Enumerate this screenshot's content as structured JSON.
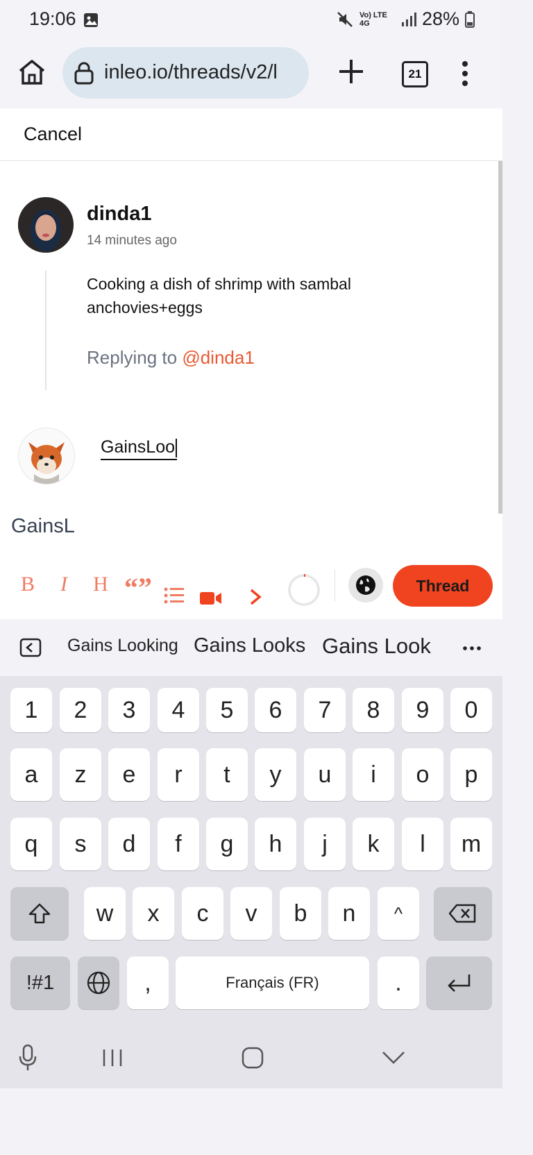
{
  "status": {
    "time": "19:06",
    "network": "Vo) LTE 4G",
    "battery": "28%"
  },
  "browser": {
    "url": "inleo.io/threads/v2/l",
    "tab_count": "21",
    "icons": [
      "home-icon",
      "lock-icon",
      "plus-icon",
      "menu-icon"
    ]
  },
  "composer": {
    "cancel_label": "Cancel",
    "parent": {
      "author": "dinda1",
      "time_ago": "14 minutes ago",
      "text": "Cooking a dish of shrimp with sambal anchovies+eggs"
    },
    "replying_prefix": "Replying to",
    "replying_handle": "@dinda1",
    "input_value": "GainsLoo",
    "preview_text": "GainsL",
    "submit_label": "Thread",
    "accent": "#f0431f"
  },
  "formatting": {
    "bold": "B",
    "italic": "I",
    "heading": "H",
    "quote": "“”"
  },
  "keyboard": {
    "suggestions": [
      "Gains Looking",
      "Gains Looks",
      "Gains Look"
    ],
    "row_numbers": [
      "1",
      "2",
      "3",
      "4",
      "5",
      "6",
      "7",
      "8",
      "9",
      "0"
    ],
    "row1": [
      "a",
      "z",
      "e",
      "r",
      "t",
      "y",
      "u",
      "i",
      "o",
      "p"
    ],
    "row2": [
      "q",
      "s",
      "d",
      "f",
      "g",
      "h",
      "j",
      "k",
      "l",
      "m"
    ],
    "row3": [
      "w",
      "x",
      "c",
      "v",
      "b",
      "n",
      "^"
    ],
    "symbols_label": "!#1",
    "comma": ",",
    "space_label": "Français (FR)",
    "period": "."
  }
}
